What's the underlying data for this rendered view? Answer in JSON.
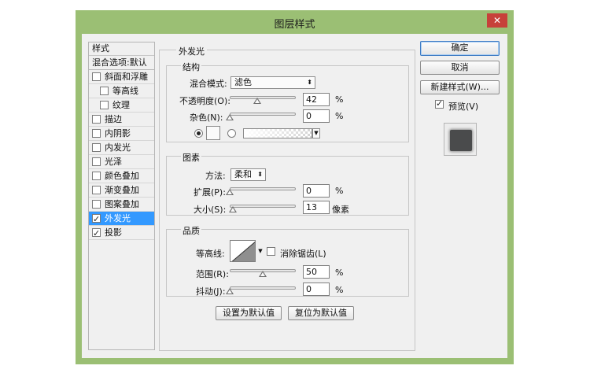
{
  "window": {
    "title": "图层样式",
    "close_symbol": "✕"
  },
  "style_list": {
    "header": "样式",
    "blend_options": "混合选项:默认",
    "items": [
      {
        "label": "斜面和浮雕",
        "checked": false,
        "indent": false
      },
      {
        "label": "等高线",
        "checked": false,
        "indent": true
      },
      {
        "label": "纹理",
        "checked": false,
        "indent": true
      },
      {
        "label": "描边",
        "checked": false,
        "indent": false
      },
      {
        "label": "内阴影",
        "checked": false,
        "indent": false
      },
      {
        "label": "内发光",
        "checked": false,
        "indent": false
      },
      {
        "label": "光泽",
        "checked": false,
        "indent": false
      },
      {
        "label": "颜色叠加",
        "checked": false,
        "indent": false
      },
      {
        "label": "渐变叠加",
        "checked": false,
        "indent": false
      },
      {
        "label": "图案叠加",
        "checked": false,
        "indent": false
      },
      {
        "label": "外发光",
        "checked": true,
        "indent": false,
        "selected": true
      },
      {
        "label": "投影",
        "checked": true,
        "indent": false
      }
    ]
  },
  "outer_glow": {
    "title": "外发光",
    "structure": {
      "title": "结构",
      "blend_mode_label": "混合模式:",
      "blend_mode_value": "滤色",
      "opacity_label": "不透明度(O):",
      "opacity_value": "42",
      "opacity_pct": 42,
      "noise_label": "杂色(N):",
      "noise_value": "0",
      "noise_pct": 0,
      "percent": "%"
    },
    "elements": {
      "title": "图素",
      "technique_label": "方法:",
      "technique_value": "柔和",
      "spread_label": "扩展(P):",
      "spread_value": "0",
      "spread_pct": 0,
      "size_label": "大小(S):",
      "size_value": "13",
      "size_pct": 5,
      "size_unit": "像素",
      "percent": "%"
    },
    "quality": {
      "title": "品质",
      "contour_label": "等高线:",
      "antialias_label": "消除锯齿(L)",
      "antialias_checked": false,
      "range_label": "范围(R):",
      "range_value": "50",
      "range_pct": 50,
      "jitter_label": "抖动(J):",
      "jitter_value": "0",
      "jitter_pct": 0,
      "percent": "%"
    },
    "make_default": "设置为默认值",
    "reset_default": "复位为默认值"
  },
  "buttons": {
    "ok": "确定",
    "cancel": "取消",
    "new_style": "新建样式(W)...",
    "preview_label": "预览(V)",
    "preview_checked": true
  },
  "colors": {
    "titlebar": "#9bbf74",
    "selection": "#3399ff",
    "close": "#c7413a"
  }
}
